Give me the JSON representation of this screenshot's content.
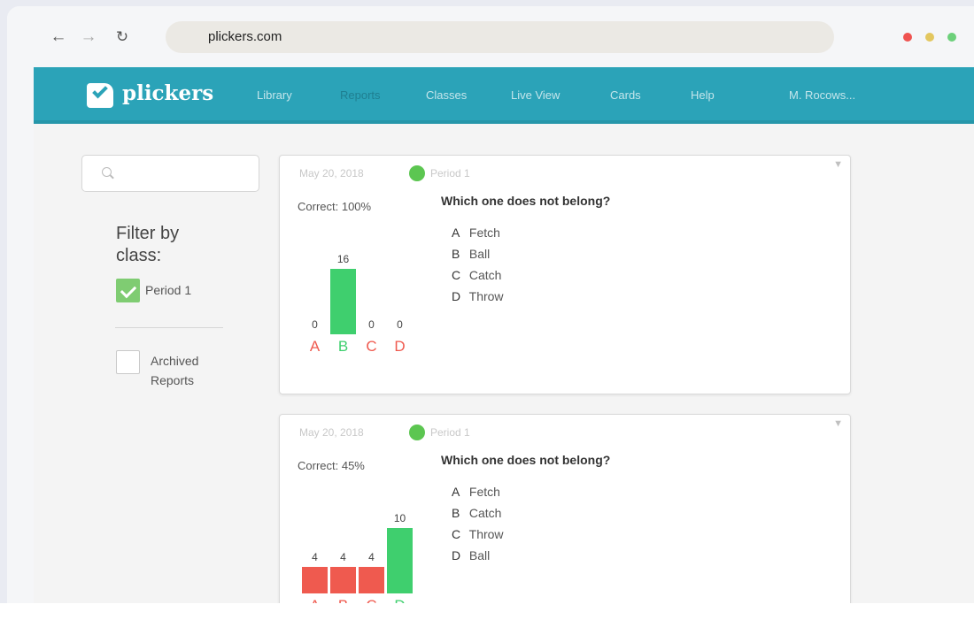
{
  "browser": {
    "url": "plickers.com",
    "dot_colors": [
      "#ef5350",
      "#e3c75f",
      "#6cd07a"
    ]
  },
  "app": {
    "logo": "plickers",
    "nav": [
      "Library",
      "Reports",
      "Classes",
      "Live View",
      "Cards",
      "Help",
      "M. Rocows..."
    ],
    "active_nav": "Reports",
    "accent": "#2ba3b8"
  },
  "sidebar": {
    "filter_title": "Filter by class:",
    "class_filter": {
      "label": "Period 1",
      "checked": true
    },
    "archived": {
      "label": "Archived Reports",
      "checked": false
    }
  },
  "reports": [
    {
      "date": "May 20, 2018",
      "class": "Period 1",
      "correct": "Correct: 100%",
      "question": "Which one does not belong?",
      "choices": [
        {
          "letter": "A",
          "text": "Fetch"
        },
        {
          "letter": "B",
          "text": "Ball"
        },
        {
          "letter": "C",
          "text": "Catch"
        },
        {
          "letter": "D",
          "text": "Throw"
        }
      ],
      "chart_data": {
        "type": "bar",
        "categories": [
          "A",
          "B",
          "C",
          "D"
        ],
        "values": [
          0,
          16,
          0,
          0
        ],
        "correct": [
          "B"
        ]
      }
    },
    {
      "date": "May 20, 2018",
      "class": "Period 1",
      "correct": "Correct: 45%",
      "question": "Which one does not belong?",
      "choices": [
        {
          "letter": "A",
          "text": "Fetch"
        },
        {
          "letter": "B",
          "text": "Catch"
        },
        {
          "letter": "C",
          "text": "Throw"
        },
        {
          "letter": "D",
          "text": "Ball"
        }
      ],
      "chart_data": {
        "type": "bar",
        "categories": [
          "A",
          "B",
          "C",
          "D"
        ],
        "values": [
          4,
          4,
          4,
          10
        ],
        "correct": [
          "D"
        ]
      }
    }
  ],
  "colors": {
    "correct": "#3fcf6e",
    "incorrect": "#ef5a4f",
    "page_bg": "#f4f4f4"
  }
}
